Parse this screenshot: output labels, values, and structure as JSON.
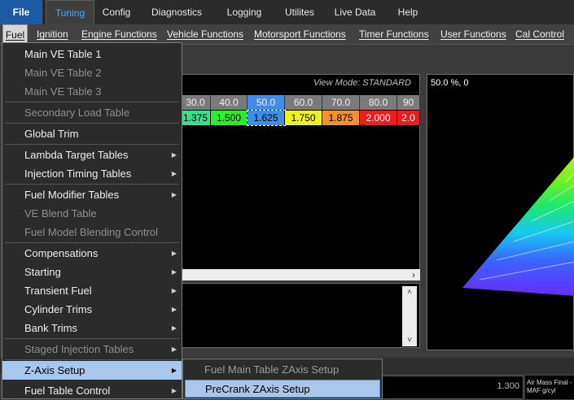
{
  "top_menu": {
    "items": [
      "File",
      "Tuning",
      "Config",
      "Diagnostics",
      "Logging",
      "Utilites",
      "Live Data",
      "Help"
    ]
  },
  "sub_menu_bar": {
    "items": [
      "Fuel",
      "Ignition",
      "Engine Functions",
      "Vehicle Functions",
      "Motorsport Functions",
      "Timer Functions",
      "User Functions",
      "Cal Control"
    ]
  },
  "table": {
    "view_mode": "View Mode: STANDARD",
    "headers": [
      "30.0",
      "40.0",
      "50.0",
      "60.0",
      "70.0",
      "80.0",
      "90"
    ],
    "values": [
      "1.375",
      "1.500",
      "1.625",
      "1.750",
      "1.875",
      "2.000",
      "2.0"
    ],
    "cell_colors": [
      "#35e08f",
      "#28f024",
      "#3d8ee8",
      "#f3f312",
      "#f5902a",
      "#f01c1c",
      "#f01c1c"
    ]
  },
  "plot": {
    "readout": "50.0 %, 0"
  },
  "status": {
    "value": "1.300",
    "info_line1": "Air Mass Final - F",
    "info_line2": "MAF g/cyl"
  },
  "fuel_menu": {
    "items": [
      {
        "label": "Main VE Table 1"
      },
      {
        "label": "Main VE Table 2"
      },
      {
        "label": "Main VE Table 3"
      },
      {
        "label": "Secondary Load Table"
      },
      {
        "label": "Global Trim"
      },
      {
        "label": "Lambda Target Tables"
      },
      {
        "label": "Injection Timing Tables"
      },
      {
        "label": "Fuel Modifier Tables"
      },
      {
        "label": "VE Blend Table"
      },
      {
        "label": "Fuel Model Blending Control"
      },
      {
        "label": "Compensations"
      },
      {
        "label": "Starting"
      },
      {
        "label": "Transient Fuel"
      },
      {
        "label": "Cylinder Trims"
      },
      {
        "label": "Bank Trims"
      },
      {
        "label": "Staged Injection Tables"
      },
      {
        "label": "Z-Axis Setup"
      },
      {
        "label": "Fuel Table Control"
      }
    ]
  },
  "zaxis_submenu": {
    "items": [
      {
        "label": "Fuel Main Table ZAxis Setup"
      },
      {
        "label": "PreCrank ZAxis Setup"
      }
    ]
  }
}
